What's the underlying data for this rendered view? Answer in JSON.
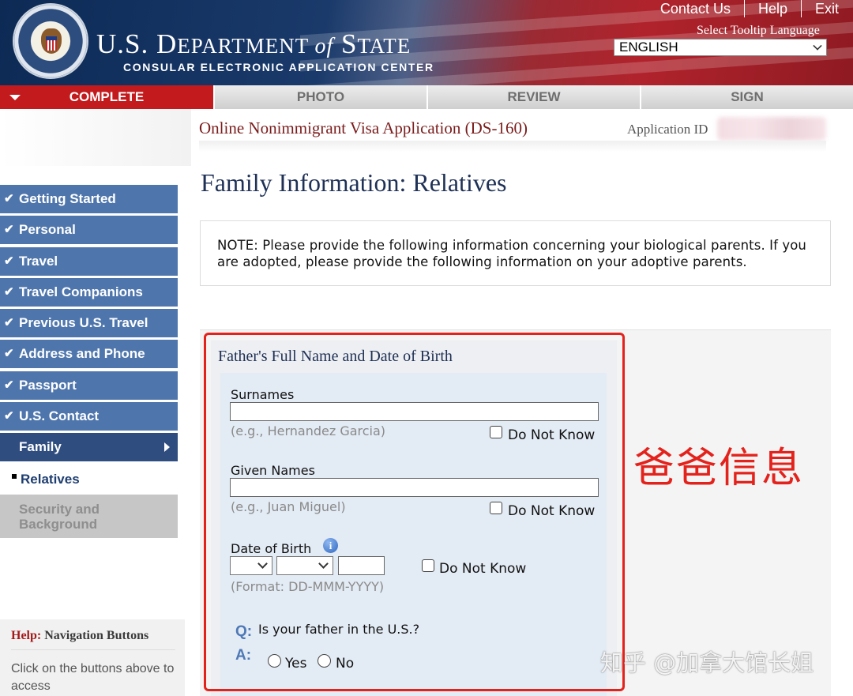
{
  "header": {
    "dept_title_main": "U.S. D",
    "dept_title_a": "EPARTMENT ",
    "dept_title_of": "of",
    "dept_title_b": " S",
    "dept_title_c": "TATE",
    "dept_subtitle": "CONSULAR ELECTRONIC APPLICATION CENTER",
    "links": [
      "Contact Us",
      "Help",
      "Exit"
    ],
    "tooltip_label": "Select Tooltip Language",
    "language_selected": "ENGLISH"
  },
  "tabs": [
    {
      "label": "COMPLETE",
      "active": true
    },
    {
      "label": "PHOTO",
      "active": false
    },
    {
      "label": "REVIEW",
      "active": false
    },
    {
      "label": "SIGN",
      "active": false
    }
  ],
  "sidebar": {
    "items": [
      "Getting Started",
      "Personal",
      "Travel",
      "Travel Companions",
      "Previous U.S. Travel",
      "Address and Phone",
      "Passport",
      "U.S. Contact"
    ],
    "current": "Family",
    "sub_current": "Relatives",
    "disabled": "Security and Background"
  },
  "help": {
    "title_red": "Help:",
    "title_rest": " Navigation Buttons",
    "text": "Click on the buttons above to access"
  },
  "app": {
    "title": "Online Nonimmigrant Visa Application (DS-160)",
    "id_label": "Application ID"
  },
  "page_title": "Family Information: Relatives",
  "note": "NOTE: Please provide the following information concerning your biological parents. If you are adopted, please provide the following information on your adoptive parents.",
  "father_section": {
    "heading": "Father's Full Name and Date of Birth",
    "surnames_label": "Surnames",
    "surnames_hint": "(e.g., Hernandez Garcia)",
    "given_label": "Given Names",
    "given_hint": "(e.g., Juan Miguel)",
    "dob_label": "Date of Birth",
    "dob_hint": "(Format: DD-MMM-YYYY)",
    "do_not_know": "Do Not Know",
    "q_marker": "Q:",
    "a_marker": "A:",
    "question": "Is your father in the U.S.?",
    "yes": "Yes",
    "no": "No"
  },
  "annotation": "爸爸信息",
  "watermark": "知乎 @加拿大馆长姐",
  "colors": {
    "accent_red": "#c21a1d",
    "nav_blue": "#4f76ac",
    "nav_current": "#2f4d7f",
    "annotation_red": "#e4221c"
  }
}
